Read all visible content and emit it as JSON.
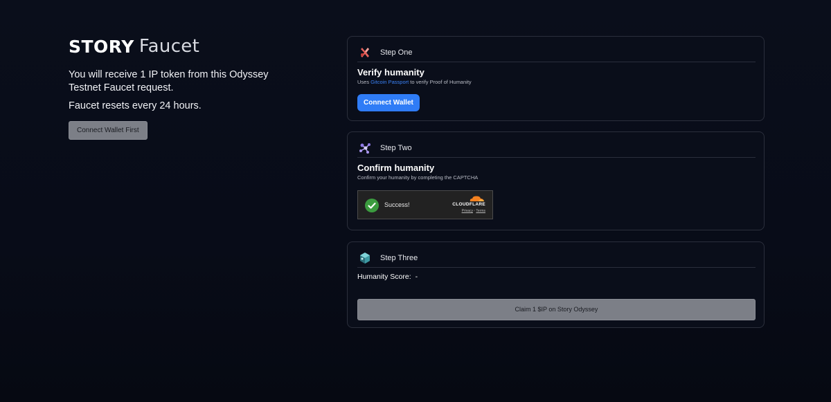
{
  "brand": {
    "name": "STORY",
    "product": "Faucet"
  },
  "intro": {
    "line1": "You will receive 1 IP token from this Odyssey Testnet Faucet request.",
    "reset": "Faucet resets every 24 hours.",
    "connect_first_label": "Connect Wallet First"
  },
  "steps": [
    {
      "label": "Step One",
      "title": "Verify humanity",
      "subtitle_prefix": "Uses ",
      "subtitle_link": "Gitcoin Passport",
      "subtitle_suffix": " to verify Proof of Humanity",
      "button_label": "Connect Wallet",
      "icon": "puzzle-x-icon"
    },
    {
      "label": "Step Two",
      "title": "Confirm humanity",
      "subtitle": "Confirm your humanity by completing the CAPTCHA",
      "captcha": {
        "status": "Success!",
        "provider": "CLOUDFLARE",
        "privacy": "Privacy",
        "separator": "·",
        "terms": "Terms"
      },
      "icon": "molecule-icon"
    },
    {
      "label": "Step Three",
      "score_label": "Humanity Score:",
      "score_value": "-",
      "claim_label": "Claim 1 $IP on Story Odyssey",
      "icon": "crystal-icon"
    }
  ],
  "colors": {
    "background": "#060912",
    "card_border": "#2b2f3c",
    "accent_blue": "#2f7cf6",
    "link_blue": "#3a82f7",
    "disabled_grey": "#7c7f87",
    "success_green": "#3b9b3f",
    "cloudflare_orange": "#f48120"
  }
}
